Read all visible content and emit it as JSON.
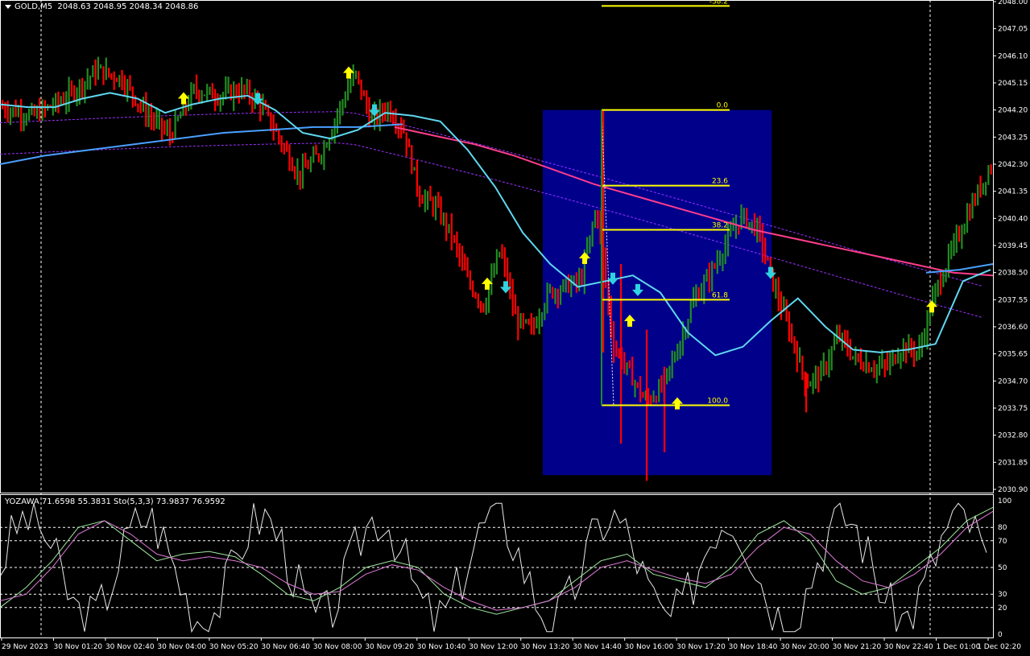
{
  "header": {
    "symbol": "GOLD,M5",
    "ohlc": "2048.63 2048.95 2048.34 2048.86",
    "indicator_label": "YOZAWA 71.6598 55.3831  Sto(5,3,3) 73.9837 76.9592"
  },
  "colors": {
    "background": "#000000",
    "bull_bar": "#228b22",
    "bear_bar": "#ff0000",
    "zone_fill": "#00008b",
    "fib_line": "#ffff00",
    "ma_fast": "#5fd7f0",
    "ma_slow": "#4aa0ff",
    "ma_long": "#ff3d8b",
    "envelope": "#9b30ff",
    "arrow_up": "#ffff00",
    "arrow_down": "#2fd3e0"
  },
  "chart_data": [
    {
      "type": "bar",
      "title": "GOLD,M5",
      "ylim": [
        2030.9,
        2048.0
      ],
      "y_ticks": [
        "2048.00",
        "2047.05",
        "2046.10",
        "2045.15",
        "2044.20",
        "2043.25",
        "2042.30",
        "2041.35",
        "2040.40",
        "2039.45",
        "2038.50",
        "2037.55",
        "2036.60",
        "2035.65",
        "2034.70",
        "2033.75",
        "2032.80",
        "2031.85",
        "2030.90"
      ],
      "x_ticks": [
        "29 Nov 2023",
        "30 Nov 01:20",
        "30 Nov 02:40",
        "30 Nov 04:00",
        "30 Nov 05:20",
        "30 Nov 06:40",
        "30 Nov 08:00",
        "30 Nov 09:20",
        "30 Nov 10:40",
        "30 Nov 12:00",
        "30 Nov 13:20",
        "30 Nov 14:40",
        "30 Nov 16:00",
        "30 Nov 17:20",
        "30 Nov 18:40",
        "30 Nov 20:00",
        "30 Nov 21:20",
        "30 Nov 22:40",
        "1 Dec 01:00",
        "1 Dec 02:20"
      ],
      "fibonacci": [
        {
          "level": "-38.2",
          "price": 2047.85
        },
        {
          "level": "0.0",
          "price": 2044.2
        },
        {
          "level": "23.6",
          "price": 2041.55
        },
        {
          "level": "38.2",
          "price": 2040.0
        },
        {
          "level": "61.8",
          "price": 2037.55
        },
        {
          "level": "100.0",
          "price": 2033.85
        }
      ],
      "zone": {
        "price_high": 2044.2,
        "price_low": 2031.4
      },
      "ma_fast": [
        2044.4,
        2044.3,
        2044.3,
        2044.6,
        2044.8,
        2044.6,
        2044.1,
        2044.4,
        2044.6,
        2044.7,
        2044.2,
        2043.4,
        2043.2,
        2043.5,
        2044.1,
        2044.0,
        2043.8,
        2042.8,
        2041.5,
        2039.9,
        2038.8,
        2038.0,
        2038.2,
        2038.4,
        2037.8,
        2036.4,
        2035.6,
        2035.9,
        2036.8,
        2037.6,
        2036.6,
        2035.8,
        2035.7,
        2035.8,
        2036.0,
        2038.2,
        2038.6
      ],
      "ma_slow": [
        2042.3,
        2042.6,
        2042.8,
        2043.0,
        2043.2,
        2043.4,
        2043.5,
        2043.6,
        2043.6,
        2043.7
      ],
      "ma_long": [
        2043.6,
        2043.3,
        2043.0,
        2042.6,
        2042.1,
        2041.6,
        2041.2,
        2040.8,
        2040.4,
        2040.0,
        2039.7,
        2039.4,
        2039.1,
        2038.8,
        2038.5,
        2038.4
      ],
      "arrows_up": [
        {
          "t": "04:00",
          "price": 2044.6
        },
        {
          "t": "08:00",
          "price": 2045.5
        },
        {
          "t": "12:00",
          "price": 2038.1
        },
        {
          "t": "14:40",
          "price": 2039.0
        },
        {
          "t": "16:00",
          "price": 2036.8
        },
        {
          "t": "17:20",
          "price": 2033.9
        },
        {
          "t": "1 Dec 01:00",
          "price": 2037.3
        }
      ],
      "arrows_down": [
        {
          "t": "05:20",
          "price": 2044.6
        },
        {
          "t": "09:20",
          "price": 2044.2
        },
        {
          "t": "12:00",
          "price": 2038.0
        },
        {
          "t": "15:20",
          "price": 2038.3
        },
        {
          "t": "16:00",
          "price": 2037.9
        },
        {
          "t": "19:20",
          "price": 2038.5
        }
      ]
    },
    {
      "type": "line",
      "title": "YOZAWA / Sto(5,3,3)",
      "ylim": [
        0,
        100
      ],
      "y_ticks": [
        "100",
        "80",
        "70",
        "50",
        "30",
        "20",
        "0"
      ],
      "series": [
        {
          "name": "Sto(5,3,3)",
          "values": [
            20,
            35,
            55,
            80,
            85,
            70,
            55,
            60,
            62,
            58,
            45,
            30,
            25,
            35,
            50,
            55,
            50,
            30,
            20,
            15,
            20,
            25,
            40,
            55,
            60,
            45,
            40,
            35,
            50,
            75,
            85,
            70,
            40,
            30,
            35,
            50,
            65,
            85,
            95
          ]
        },
        {
          "name": "YOZAWA",
          "values": [
            25,
            30,
            50,
            75,
            85,
            75,
            60,
            55,
            58,
            55,
            50,
            38,
            30,
            32,
            45,
            52,
            48,
            35,
            25,
            18,
            20,
            25,
            35,
            50,
            55,
            48,
            42,
            38,
            45,
            65,
            80,
            75,
            55,
            40,
            35,
            45,
            60,
            80,
            92
          ]
        }
      ]
    }
  ]
}
